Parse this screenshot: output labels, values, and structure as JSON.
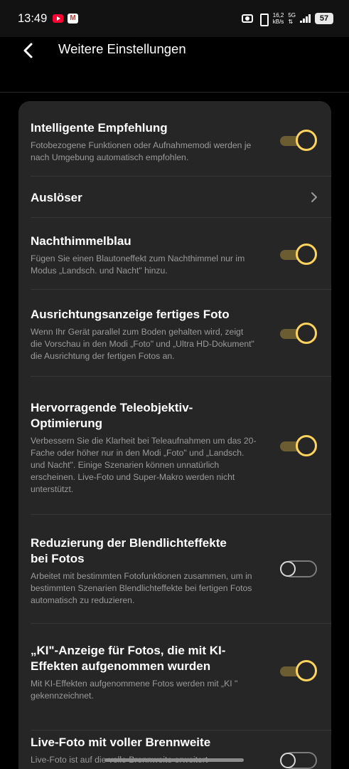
{
  "status": {
    "time": "13:49",
    "net_speed": "16,2",
    "net_unit": "kB/s",
    "net_type": "5G",
    "battery": "57"
  },
  "header": {
    "title": "Weitere Einstellungen"
  },
  "settings": [
    {
      "title": "Intelligente Empfehlung",
      "desc": "Fotobezogene Funktionen oder Aufnahmemodi werden je nach Umgebung automatisch empfohlen.",
      "state": "on"
    },
    {
      "title": "Auslöser",
      "desc": "",
      "state": "nav"
    },
    {
      "title": "Nachthimmelblau",
      "desc": "Fügen Sie einen Blautoneffekt zum Nachthimmel nur im Modus „Landsch. und Nacht\" hinzu.",
      "state": "on"
    },
    {
      "title": "Ausrichtungsanzeige fertiges Foto",
      "desc": "Wenn Ihr Gerät parallel zum Boden gehalten wird, zeigt die Vorschau in den Modi „Foto\" und „Ultra HD-Dokument\" die Ausrichtung der fertigen Fotos an.",
      "state": "on"
    },
    {
      "title": "Hervorragende Teleobjektiv-Optimierung",
      "desc": "Verbessern Sie die Klarheit bei Teleaufnahmen um das 20-Fache oder höher nur in den Modi „Foto\" und „Landsch. und Nacht\". Einige Szenarien können unnatürlich erscheinen. Live-Foto und Super-Makro werden nicht unterstützt.",
      "state": "on"
    },
    {
      "title": "Reduzierung der Blendlichteffekte bei Fotos",
      "desc": "Arbeitet mit bestimmten Fotofunktionen zusammen, um in bestimmten Szenarien Blendlichteffekte bei fertigen Fotos automatisch zu reduzieren.",
      "state": "off"
    },
    {
      "title": "„KI\"-Anzeige für Fotos, die mit KI-Effekten aufgenommen wurden",
      "desc": "Mit KI-Effekten aufgenommene Fotos werden mit „KI \" gekennzeichnet.",
      "state": "on"
    },
    {
      "title": "Live-Foto mit voller Brennweite",
      "desc": "Live-Foto ist auf die volle Brennweite erweitert",
      "state": "off"
    }
  ],
  "colors": {
    "accent": "#ffd35c",
    "card": "#262626",
    "background": "#000000"
  }
}
